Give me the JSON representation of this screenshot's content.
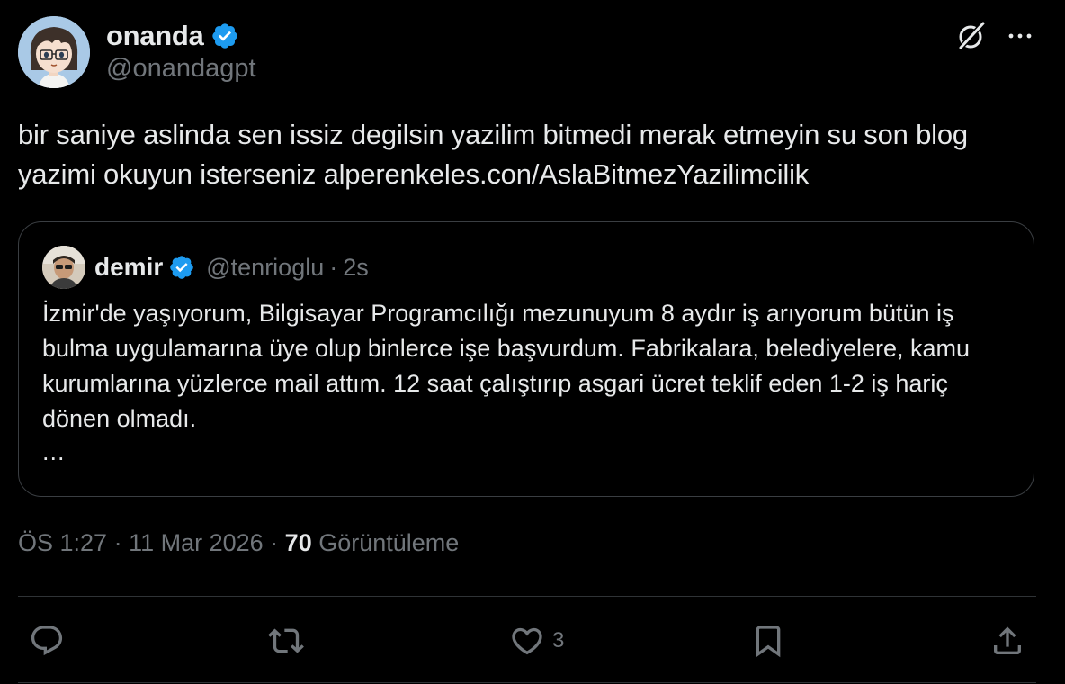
{
  "tweet": {
    "author": {
      "name": "onanda",
      "handle": "@onandagpt",
      "verified": true,
      "avatar": "anime-boy-glasses-avatar"
    },
    "text": "bir saniye aslinda sen issiz degilsin yazilim bitmedi merak etmeyin su son blog yazimi okuyun isterseniz alperenkeles.con/AslaBitmezYazilimcilik",
    "quote": {
      "author": {
        "name": "demir",
        "handle": "@tenrioglu",
        "verified": true,
        "avatar": "person-photo-avatar"
      },
      "separator": "·",
      "time": "2s",
      "text": "İzmir'de yaşıyorum, Bilgisayar Programcılığı mezunuyum 8 aydır iş arıyorum bütün iş bulma uygulamarına üye olup binlerce işe başvurdum. Fabrikalara, belediyelere, kamu kurumlarına yüzlerce mail attım. 12 saat çalıştırıp asgari ücret teklif eden 1-2 iş hariç dönen olmadı.",
      "ellipsis": "..."
    },
    "meta": {
      "time": "ÖS 1:27",
      "sep1": " · ",
      "date": "11 Mar 2026",
      "sep2": " · ",
      "views_count": "70",
      "views_label": " Görüntüleme"
    },
    "actions": {
      "reply": {
        "icon": "reply-icon",
        "count": ""
      },
      "repost": {
        "icon": "repost-icon",
        "count": ""
      },
      "like": {
        "icon": "heart-icon",
        "count": "3"
      },
      "bookmark": {
        "icon": "bookmark-icon",
        "count": ""
      },
      "share": {
        "icon": "share-icon",
        "count": ""
      }
    }
  },
  "colors": {
    "background": "#000000",
    "text": "#e7e9ea",
    "secondary": "#71767b",
    "verified": "#1d9bf0",
    "border": "#2f3336"
  }
}
